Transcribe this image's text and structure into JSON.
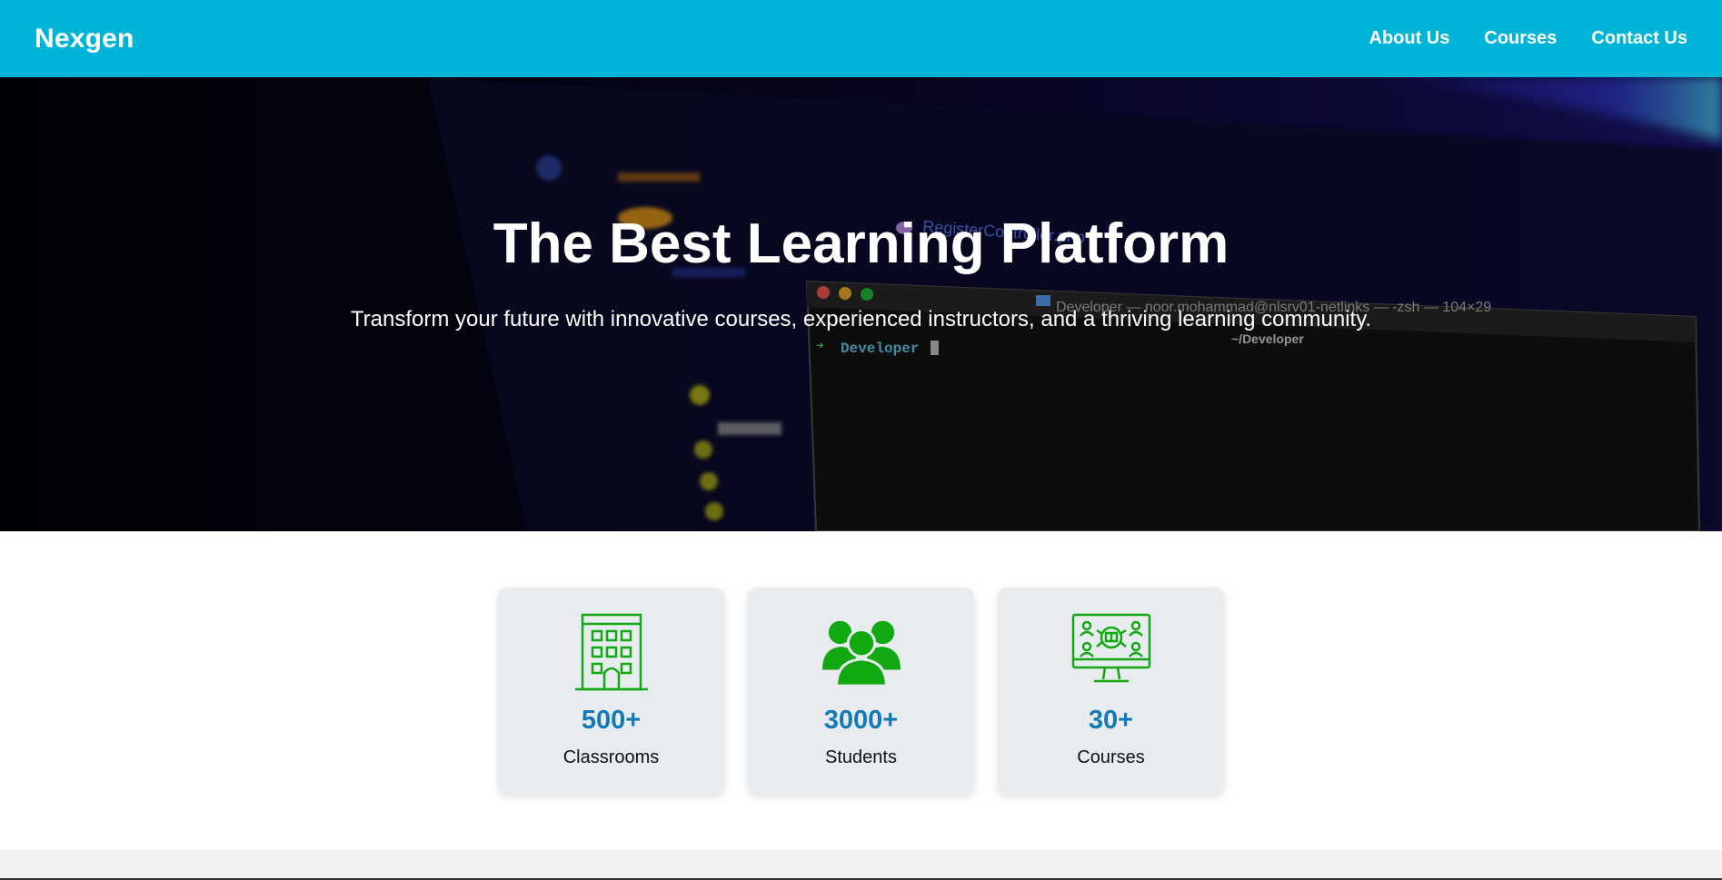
{
  "header": {
    "brand": "Nexgen",
    "nav": [
      {
        "label": "About Us"
      },
      {
        "label": "Courses"
      },
      {
        "label": "Contact Us"
      }
    ],
    "bg_color": "#00b4d8"
  },
  "hero": {
    "title": "The Best Learning Platform",
    "subtitle": "Transform your future with innovative courses, experienced instructors, and a thriving learning community.",
    "background_image": "blurred-code-terminal-photo"
  },
  "stats": [
    {
      "icon": "building-icon",
      "value": "500+",
      "label": "Classrooms"
    },
    {
      "icon": "users-group-icon",
      "value": "3000+",
      "label": "Students"
    },
    {
      "icon": "online-class-monitor-icon",
      "value": "30+",
      "label": "Courses"
    }
  ],
  "colors": {
    "accent": "#1479b8",
    "icon_green": "#12a812",
    "card_bg": "#e9ecef"
  }
}
